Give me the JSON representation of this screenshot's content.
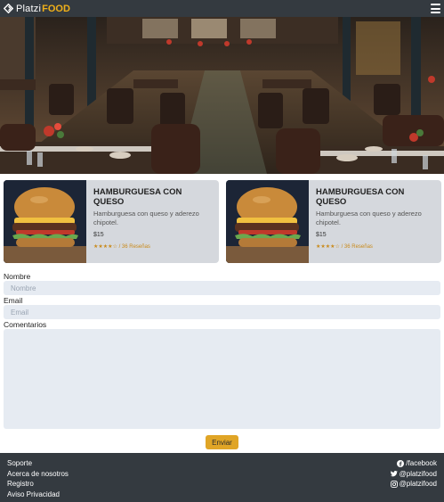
{
  "navbar": {
    "brand_name": "Platzi",
    "brand_accent": "FOOD",
    "logo_icon": "platzi-logo-icon",
    "menu_icon": "hamburger-menu-icon"
  },
  "hero": {
    "image": "restaurant-interior-photo"
  },
  "products": [
    {
      "title": "HAMBURGUESA CON QUESO",
      "description": "Hamburguesa con queso y aderezo chipotel.",
      "price": "$15",
      "rating_stars": "★★★★☆",
      "rating": 4,
      "rating_text": " / 36 Reseñas",
      "image": "burger-photo"
    },
    {
      "title": "HAMBURGUESA CON QUESO",
      "description": "Hamburguesa con queso y aderezo chipotel.",
      "price": "$15",
      "rating_stars": "★★★★☆",
      "rating": 4,
      "rating_text": " / 36 Reseñas",
      "image": "burger-photo"
    }
  ],
  "form": {
    "name_label": "Nombre",
    "name_placeholder": "Nombre",
    "name_value": "",
    "email_label": "Email",
    "email_placeholder": "Email",
    "email_value": "",
    "comments_label": "Comentarios",
    "comments_value": "",
    "submit_label": "Enviar"
  },
  "footer": {
    "links": [
      "Soporte",
      "Acerca de nosotros",
      "Registro",
      "Aviso Privacidad"
    ],
    "social": [
      {
        "icon": "facebook-icon",
        "label": "/facebook"
      },
      {
        "icon": "twitter-icon",
        "label": "@platzifood"
      },
      {
        "icon": "instagram-icon",
        "label": "@platzifood"
      }
    ]
  },
  "colors": {
    "navbar_bg": "#343a40",
    "accent": "#f0b019",
    "button": "#e0a526",
    "card_bg": "#d5d8dd",
    "input_bg": "#e6ebf2"
  }
}
